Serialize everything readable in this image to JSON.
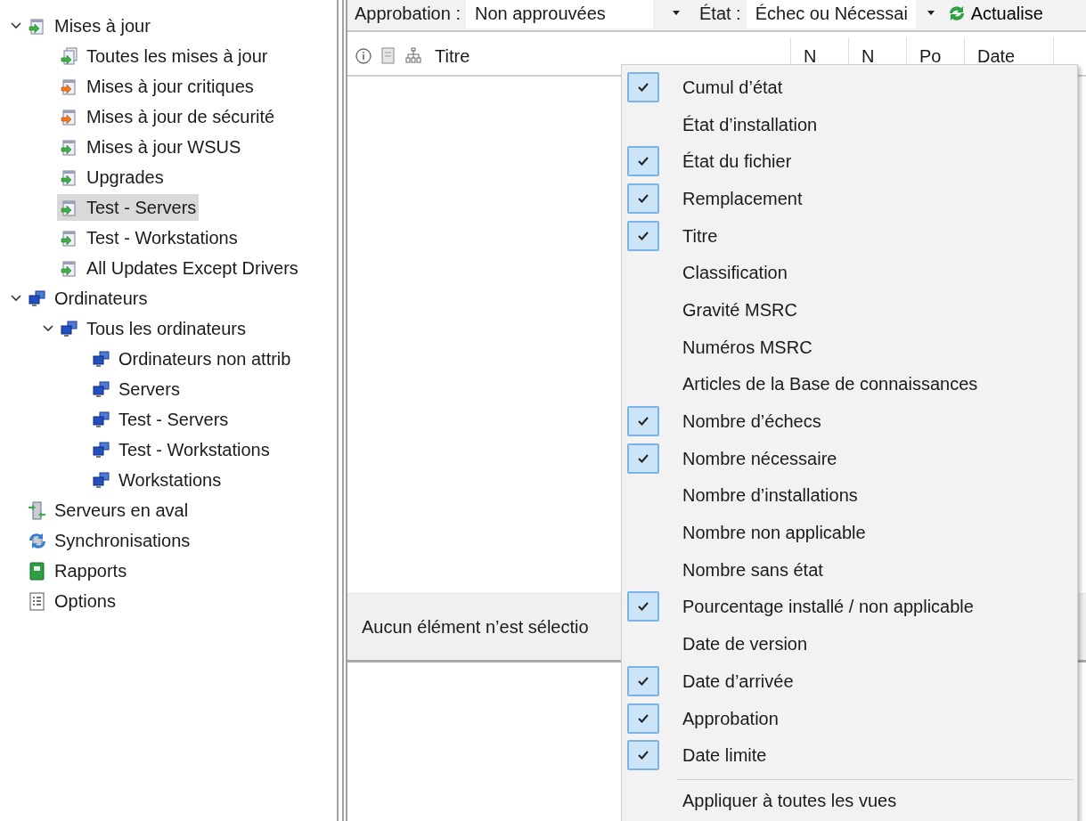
{
  "sidebar": {
    "tree": [
      {
        "label": "Mises à jour",
        "kind": "updates",
        "expanded": true,
        "selected": false,
        "children": [
          {
            "label": "Toutes les mises à jour",
            "kind": "all-updates",
            "selected": false
          },
          {
            "label": "Mises à jour critiques",
            "kind": "critical",
            "selected": false
          },
          {
            "label": "Mises à jour de sécurité",
            "kind": "critical",
            "selected": false
          },
          {
            "label": "Mises à jour WSUS",
            "kind": "updates",
            "selected": false
          },
          {
            "label": "Upgrades",
            "kind": "updates",
            "selected": false
          },
          {
            "label": "Test - Servers",
            "kind": "updates",
            "selected": true
          },
          {
            "label": "Test - Workstations",
            "kind": "updates",
            "selected": false
          },
          {
            "label": "All Updates Except Drivers",
            "kind": "updates",
            "selected": false
          }
        ]
      },
      {
        "label": "Ordinateurs",
        "kind": "computers",
        "expanded": true,
        "selected": false,
        "children": [
          {
            "label": "Tous les ordinateurs",
            "kind": "computers",
            "expanded": true,
            "selected": false,
            "children": [
              {
                "label": "Ordinateurs non attrib",
                "kind": "computers",
                "selected": false
              },
              {
                "label": "Servers",
                "kind": "computers",
                "selected": false
              },
              {
                "label": "Test - Servers",
                "kind": "computers",
                "selected": false
              },
              {
                "label": "Test - Workstations",
                "kind": "computers",
                "selected": false
              },
              {
                "label": "Workstations",
                "kind": "computers",
                "selected": false
              }
            ]
          }
        ]
      },
      {
        "label": "Serveurs en aval",
        "kind": "downstream",
        "selected": false
      },
      {
        "label": "Synchronisations",
        "kind": "sync",
        "selected": false
      },
      {
        "label": "Rapports",
        "kind": "reports",
        "selected": false
      },
      {
        "label": "Options",
        "kind": "options",
        "selected": false
      }
    ]
  },
  "toolbar": {
    "approval_label": "Approbation :",
    "approval_value": "Non approuvées",
    "status_label": "État :",
    "status_value": "Échec ou Nécessai",
    "refresh_label": "Actualise"
  },
  "table": {
    "columns": [
      "Titre",
      "N",
      "N",
      "Po",
      "Date"
    ]
  },
  "details": {
    "text": "Aucun élément n’est sélectio"
  },
  "context_menu": {
    "items": [
      {
        "label": "Cumul d’état",
        "checked": true
      },
      {
        "label": "État d’installation",
        "checked": false
      },
      {
        "label": "État du fichier",
        "checked": true
      },
      {
        "label": "Remplacement",
        "checked": true
      },
      {
        "label": "Titre",
        "checked": true
      },
      {
        "label": "Classification",
        "checked": false
      },
      {
        "label": "Gravité MSRC",
        "checked": false
      },
      {
        "label": "Numéros MSRC",
        "checked": false
      },
      {
        "label": "Articles de la Base de connaissances",
        "checked": false
      },
      {
        "label": "Nombre d’échecs",
        "checked": true
      },
      {
        "label": "Nombre nécessaire",
        "checked": true
      },
      {
        "label": "Nombre d’installations",
        "checked": false
      },
      {
        "label": "Nombre non applicable",
        "checked": false
      },
      {
        "label": "Nombre sans état",
        "checked": false
      },
      {
        "label": "Pourcentage installé / non applicable",
        "checked": true
      },
      {
        "label": "Date de version",
        "checked": false
      },
      {
        "label": "Date d’arrivée",
        "checked": true
      },
      {
        "label": "Approbation",
        "checked": true
      },
      {
        "label": "Date limite",
        "checked": true
      }
    ],
    "footer_item": "Appliquer à toutes les vues"
  }
}
